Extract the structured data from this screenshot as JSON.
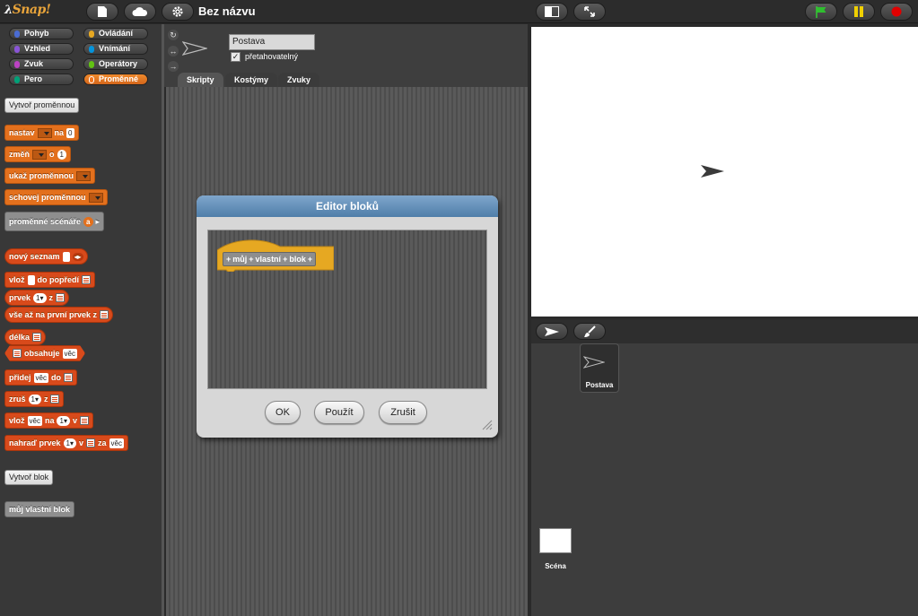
{
  "app": {
    "logo_text": "Snap!"
  },
  "topbar": {
    "title": "Bez názvu"
  },
  "categories": [
    {
      "label": "Pohyb",
      "color": "#4a6cd4"
    },
    {
      "label": "Ovládání",
      "color": "#e6a822"
    },
    {
      "label": "Vzhled",
      "color": "#8a55d7"
    },
    {
      "label": "Vnímání",
      "color": "#0494dc"
    },
    {
      "label": "Zvuk",
      "color": "#bb42c3"
    },
    {
      "label": "Operátory",
      "color": "#62c213"
    },
    {
      "label": "Pero",
      "color": "#00a178"
    },
    {
      "label": "Proměnné",
      "color": "#f3761d",
      "active": true
    }
  ],
  "palette": {
    "make_variable": "Vytvoř proměnnou",
    "set_a": "nastav",
    "set_b": "na",
    "set_val": "0",
    "change_a": "změň",
    "change_b": "o",
    "change_val": "1",
    "show_var": "ukaž proměnnou",
    "hide_var": "schovej proměnnou",
    "script_vars": "proměnné scénáře",
    "script_vars_slot": "a",
    "new_list": "nový seznam",
    "insert_front_a": "vlož",
    "insert_front_b": "do popředí",
    "item_a": "prvek",
    "item_val": "1",
    "item_b": "z",
    "all_but_first": "vše až na první prvek z",
    "length": "délka",
    "contains": "obsahuje",
    "contains_val": "věc",
    "add_a": "přidej",
    "add_val": "věc",
    "add_b": "do",
    "delete_a": "zruš",
    "delete_val": "1",
    "delete_b": "z",
    "insert_a": "vlož",
    "insert_val": "věc",
    "insert_b": "na",
    "insert_idx": "1",
    "insert_c": "v",
    "replace_a": "nahraď prvek",
    "replace_idx": "1",
    "replace_b": "v",
    "replace_c": "za",
    "replace_val": "věc",
    "make_block": "Vytvoř blok",
    "custom_block": "můj vlastní blok"
  },
  "sprite": {
    "name": "Postava",
    "draggable_label": "přetahovatelný",
    "draggable_checked": "✓"
  },
  "tabs": [
    "Skripty",
    "Kostýmy",
    "Zvuky"
  ],
  "dialog": {
    "title": "Editor bloků",
    "hat_words": [
      "můj",
      "vlastní",
      "blok"
    ],
    "ok": "OK",
    "apply": "Použít",
    "cancel": "Zrušit"
  },
  "corral": {
    "sprite_label": "Postava",
    "stage_label": "Scéna"
  }
}
